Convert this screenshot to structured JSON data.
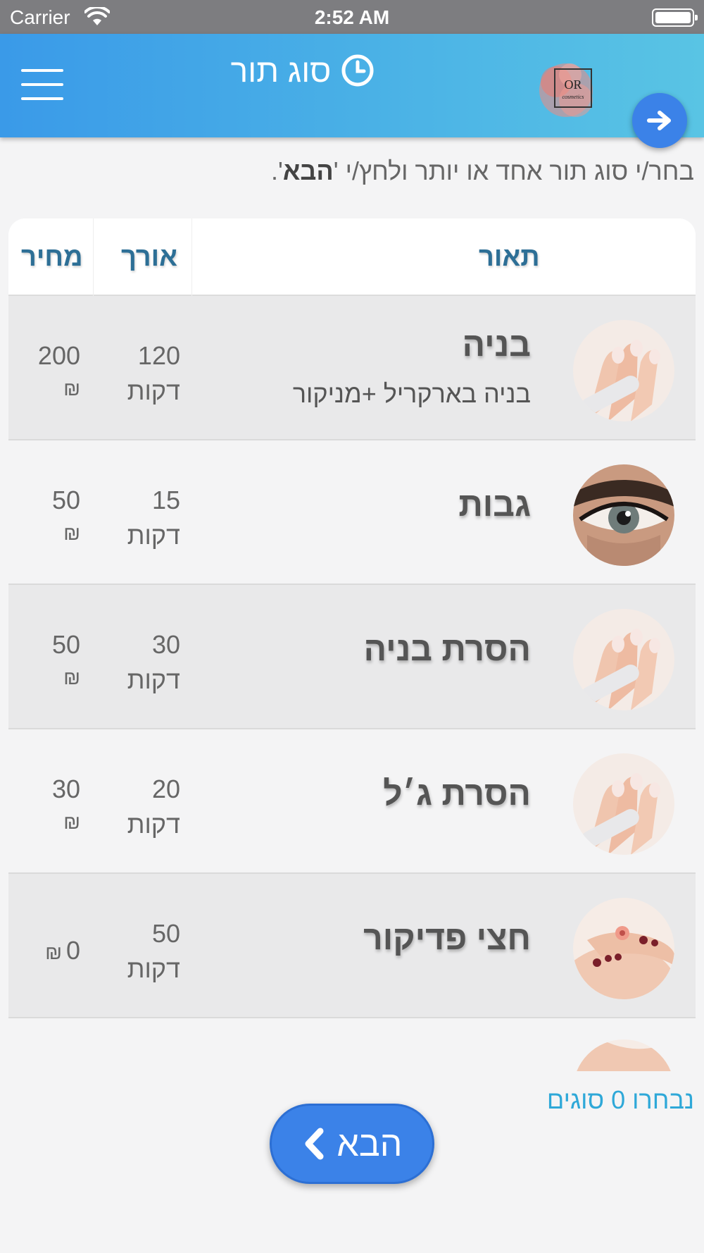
{
  "status_bar": {
    "carrier": "Carrier",
    "time": "2:52 AM"
  },
  "header": {
    "title": "סוג תור",
    "logo_text": "OR",
    "logo_subtext": "cosmetics"
  },
  "instructions": {
    "prefix": "בחר/י סוג תור אחד או יותר ולחץ/י '",
    "bold": "הבא",
    "suffix": "'."
  },
  "table": {
    "columns": {
      "description": "תאור",
      "length": "אורך",
      "price": "מחיר"
    },
    "rows": [
      {
        "name": "בניה",
        "subtitle": "בניה בארקריל +מניקור",
        "length": "120",
        "length_unit": "דקות",
        "price": "200",
        "currency": "₪",
        "image": "hand-nails"
      },
      {
        "name": "גבות",
        "subtitle": "",
        "length": "15",
        "length_unit": "דקות",
        "price": "50",
        "currency": "₪",
        "image": "eye"
      },
      {
        "name": "הסרת בניה",
        "subtitle": "",
        "length": "30",
        "length_unit": "דקות",
        "price": "50",
        "currency": "₪",
        "image": "hand-nails"
      },
      {
        "name": "הסרת ג׳ל",
        "subtitle": "",
        "length": "20",
        "length_unit": "דקות",
        "price": "30",
        "currency": "₪",
        "image": "hand-nails"
      },
      {
        "name": "חצי פדיקור",
        "subtitle": "",
        "length": "50",
        "length_unit": "דקות",
        "price": "0",
        "currency": "₪",
        "image": "feet-pedicure"
      }
    ]
  },
  "footer": {
    "selected_count": "נבחרו 0 סוגים",
    "next_label": "הבא"
  },
  "colors": {
    "header_start": "#3a9ae8",
    "header_end": "#59c4e4",
    "accent_button": "#3b82e8",
    "column_header": "#2d6f96",
    "count_text": "#2ea8d8"
  }
}
